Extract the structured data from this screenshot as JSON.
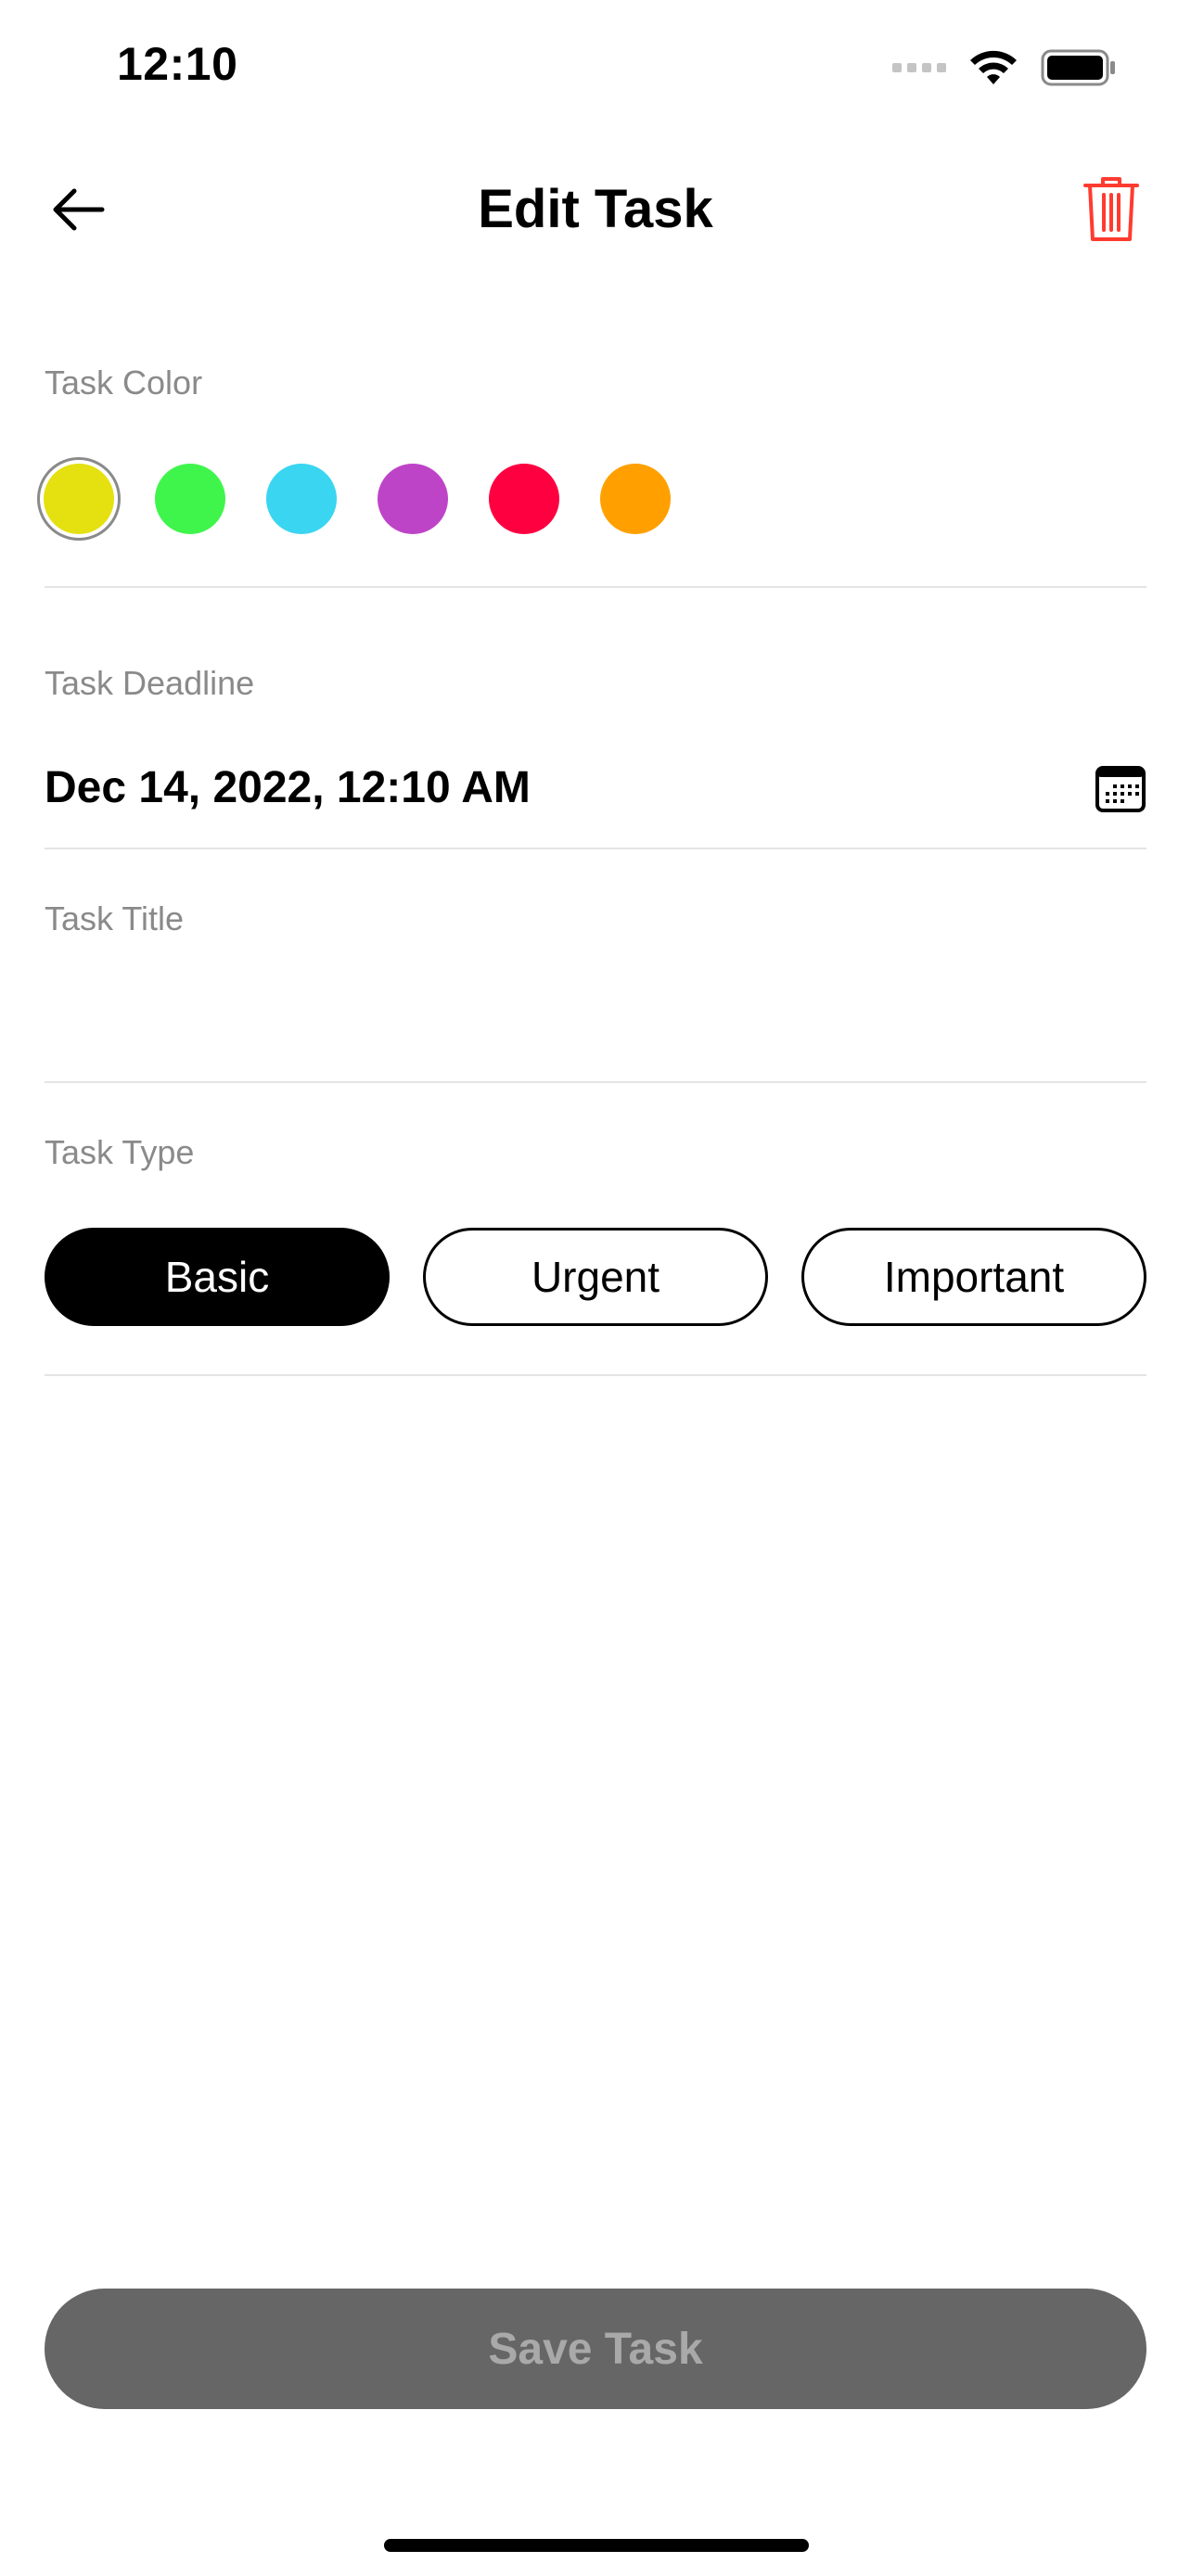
{
  "status_bar": {
    "time": "12:10",
    "icons": [
      "cellular-signal-icon",
      "wifi-icon",
      "battery-icon"
    ]
  },
  "nav": {
    "title": "Edit Task",
    "back_icon": "arrow-left-icon",
    "delete_icon": "trash-icon"
  },
  "task_color": {
    "label": "Task Color",
    "swatches": [
      "#e5e010",
      "#3ff54c",
      "#3ad5f1",
      "#be44c7",
      "#fe0040",
      "#ffa000"
    ],
    "selected_index": 0
  },
  "task_deadline": {
    "label": "Task Deadline",
    "value": "Dec 14, 2022, 12:10 AM",
    "icon": "calendar-icon"
  },
  "task_title": {
    "label": "Task Title",
    "value": ""
  },
  "task_type": {
    "label": "Task Type",
    "options": [
      "Basic",
      "Urgent",
      "Important"
    ],
    "selected": "Basic"
  },
  "save_button": {
    "label": "Save Task"
  },
  "colors": {
    "delete_red": "#ff3b30",
    "save_bg": "#666666",
    "save_text": "#a9a9a9",
    "label_gray": "#8a8a8a"
  }
}
